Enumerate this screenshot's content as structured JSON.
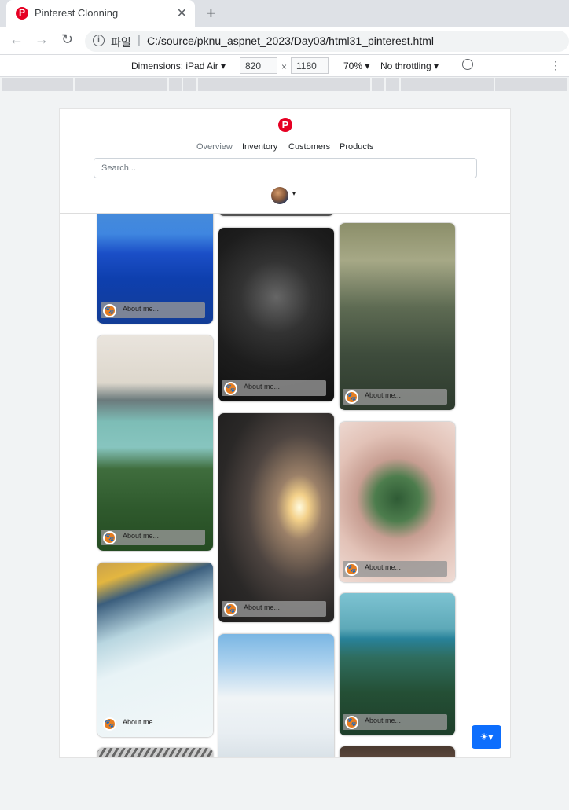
{
  "browser": {
    "tab_title": "Pinterest Clonning",
    "tab_close": "✕",
    "new_tab": "+",
    "scheme_label": "파일",
    "url_separator": "|",
    "url": "C:/source/pknu_aspnet_2023/Day03/html31_pinterest.html"
  },
  "devtools": {
    "dimensions_label": "Dimensions: iPad Air ▾",
    "width": "820",
    "times": "×",
    "height": "1180",
    "zoom": "70% ▾",
    "throttling": "No throttling ▾",
    "more": "⋮"
  },
  "page": {
    "logo": "P",
    "nav": {
      "overview": "Overview",
      "inventory": "Inventory",
      "customers": "Customers",
      "products": "Products"
    },
    "search_placeholder": "Search...",
    "user_caret": "▾",
    "theme_button": "☀▾",
    "card_avatar_glyph": "🐾",
    "cards": [
      {
        "column": 1,
        "photo": "blue lake",
        "caption": "About me..."
      },
      {
        "column": 1,
        "photo": "fjord with forest",
        "caption": "About me..."
      },
      {
        "column": 1,
        "photo": "hot air balloon",
        "caption": "About me..."
      },
      {
        "column": 1,
        "photo": "striped pattern",
        "caption": ""
      },
      {
        "column": 2,
        "photo": "dark",
        "caption": ""
      },
      {
        "column": 2,
        "photo": "person with camera",
        "caption": "About me..."
      },
      {
        "column": 2,
        "photo": "train platform",
        "caption": "About me..."
      },
      {
        "column": 2,
        "photo": "cloudy sky",
        "caption": ""
      },
      {
        "column": 3,
        "photo": "foggy forest",
        "caption": "About me..."
      },
      {
        "column": 3,
        "photo": "hands holding pine",
        "caption": "About me..."
      },
      {
        "column": 3,
        "photo": "lake and trees",
        "caption": "About me..."
      },
      {
        "column": 3,
        "photo": "dog",
        "caption": ""
      }
    ]
  }
}
